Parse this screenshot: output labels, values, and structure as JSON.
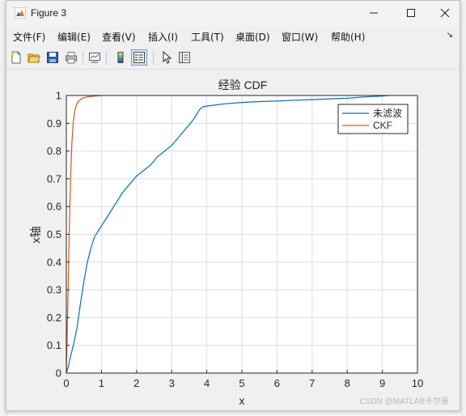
{
  "window": {
    "title": "Figure 3"
  },
  "menu": {
    "items": [
      "文件(F)",
      "编辑(E)",
      "查看(V)",
      "插入(I)",
      "工具(T)",
      "桌面(D)",
      "窗口(W)",
      "帮助(H)"
    ],
    "overflow_arrow": "↘"
  },
  "toolbar": {
    "icons": [
      "new-figure-icon",
      "open-file-icon",
      "save-icon",
      "print-icon",
      "link-plot-icon",
      "colorbar-icon",
      "legend-icon",
      "edit-plot-arrow-icon",
      "property-inspector-icon"
    ],
    "active": "legend-icon"
  },
  "chart_data": {
    "type": "line",
    "title": "经验 CDF",
    "xlabel": "x",
    "ylabel": "x轴",
    "xlim": [
      0,
      10
    ],
    "ylim": [
      0,
      1
    ],
    "xticks": [
      "0",
      "1",
      "2",
      "3",
      "4",
      "5",
      "6",
      "7",
      "8",
      "9",
      "10"
    ],
    "yticks": [
      "0",
      "0.1",
      "0.2",
      "0.3",
      "0.4",
      "0.5",
      "0.6",
      "0.7",
      "0.8",
      "0.9",
      "1"
    ],
    "grid": true,
    "legend_position": "top-right",
    "series": [
      {
        "name": "未滤波",
        "color": "#0072bd",
        "x": [
          0,
          0.05,
          0.1,
          0.2,
          0.3,
          0.4,
          0.5,
          0.6,
          0.7,
          0.8,
          0.9,
          1.0,
          1.2,
          1.4,
          1.6,
          1.8,
          2.0,
          2.2,
          2.4,
          2.6,
          2.8,
          3.0,
          3.2,
          3.4,
          3.6,
          3.7,
          3.8,
          3.9,
          4.0,
          4.2,
          4.5,
          5.0,
          5.5,
          6.0,
          6.5,
          7.0,
          7.5,
          8.0,
          8.5,
          9.0,
          9.2
        ],
        "y": [
          0,
          0.02,
          0.05,
          0.1,
          0.16,
          0.25,
          0.33,
          0.4,
          0.45,
          0.49,
          0.51,
          0.53,
          0.57,
          0.61,
          0.65,
          0.68,
          0.71,
          0.73,
          0.75,
          0.78,
          0.8,
          0.82,
          0.85,
          0.88,
          0.91,
          0.93,
          0.95,
          0.96,
          0.962,
          0.965,
          0.97,
          0.975,
          0.978,
          0.98,
          0.983,
          0.985,
          0.988,
          0.99,
          0.995,
          0.998,
          1.0
        ]
      },
      {
        "name": "CKF",
        "color": "#d95319",
        "x": [
          0,
          0.02,
          0.05,
          0.08,
          0.12,
          0.16,
          0.2,
          0.25,
          0.3,
          0.35,
          0.45,
          0.6,
          0.8,
          1.0
        ],
        "y": [
          0,
          0.12,
          0.3,
          0.5,
          0.7,
          0.83,
          0.91,
          0.95,
          0.97,
          0.98,
          0.99,
          0.995,
          0.998,
          1.0
        ]
      }
    ]
  },
  "watermark": "CSDN @MATLAB卡尔曼"
}
